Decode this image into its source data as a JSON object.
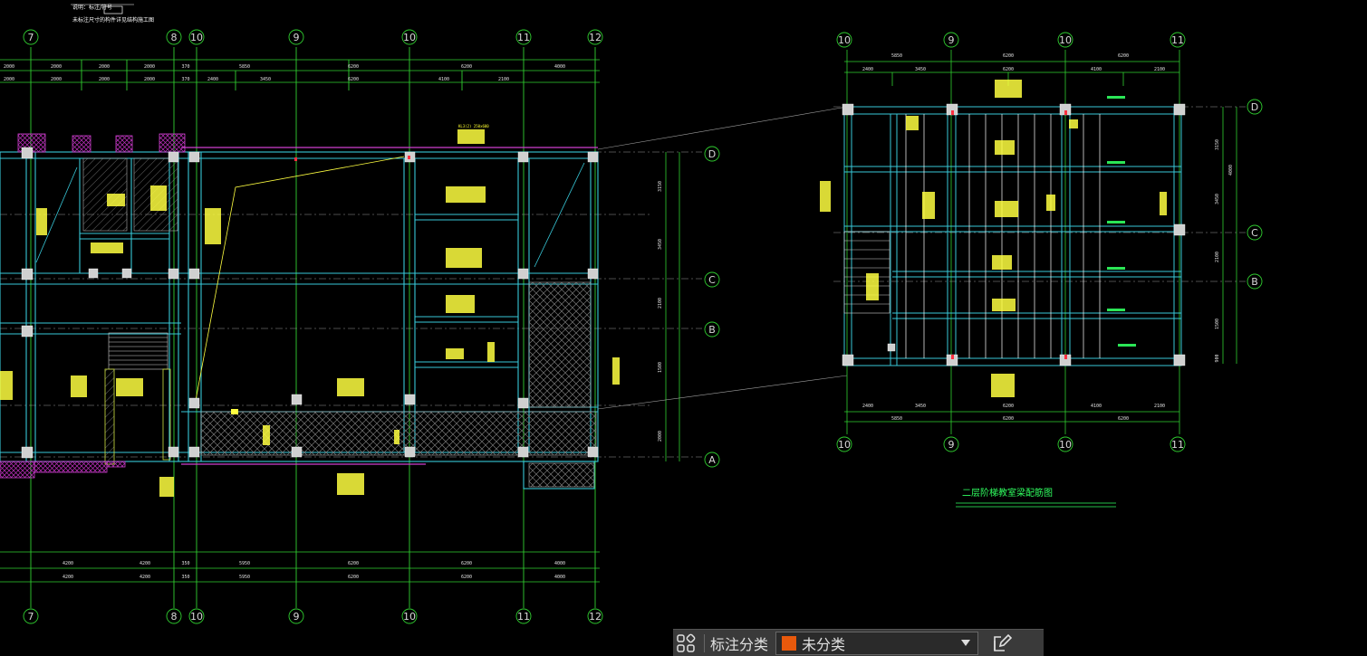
{
  "drawing": {
    "header_note_1": "说明：标注/符号",
    "header_note_2": "未标注尺寸的构件详见结构施工图",
    "title": "二层阶梯教室梁配筋图",
    "left_plan": {
      "top_axes": [
        "7",
        "8",
        "10",
        "9",
        "10",
        "11",
        "12"
      ],
      "bottom_axes": [
        "7",
        "8",
        "10",
        "9",
        "10",
        "11",
        "12"
      ],
      "right_axes": [
        "D",
        "C",
        "B",
        "A"
      ],
      "top_dims_row1": [
        "2000",
        "2000",
        "2000",
        "2000",
        "370",
        "5850",
        "6200",
        "6200",
        "4000"
      ],
      "top_dims_row2": [
        "2000",
        "2000",
        "2000",
        "2000",
        "370",
        "2400",
        "3450",
        "6200",
        "4100",
        "2100"
      ],
      "right_dims": [
        "3150",
        "3450",
        "2100",
        "1500",
        "2000"
      ],
      "bottom_dims_row1": [
        "4200",
        "4200",
        "350",
        "5950",
        "6200",
        "6200",
        "4000"
      ],
      "bottom_dims_row2": [
        "4200",
        "4200",
        "350",
        "5950",
        "6200",
        "6200",
        "4000"
      ]
    },
    "right_plan": {
      "top_axes": [
        "10",
        "9",
        "10",
        "11"
      ],
      "bottom_axes": [
        "10",
        "9",
        "10",
        "11"
      ],
      "right_axes": [
        "D",
        "C",
        "B"
      ],
      "top_dims_row1": [
        "5850",
        "6200",
        "6200"
      ],
      "top_dims_row2": [
        "2400",
        "3450",
        "6200",
        "4100",
        "2100"
      ],
      "right_dims": [
        "3150",
        "4000",
        "3450",
        "2100",
        "1500",
        "900"
      ],
      "bottom_dims_row1": [
        "2400",
        "3450",
        "6200",
        "4100",
        "2100"
      ],
      "bottom_dims_row2": [
        "5850",
        "6200",
        "6200"
      ]
    },
    "beam_tag": "KL3(2) 250x600"
  },
  "anno_toolbar": {
    "icon_left": "component-grid-icon",
    "label": "标注分类",
    "selected_category": "未分类",
    "selected_color": "#e8590c",
    "icon_right": "edit-icon"
  }
}
